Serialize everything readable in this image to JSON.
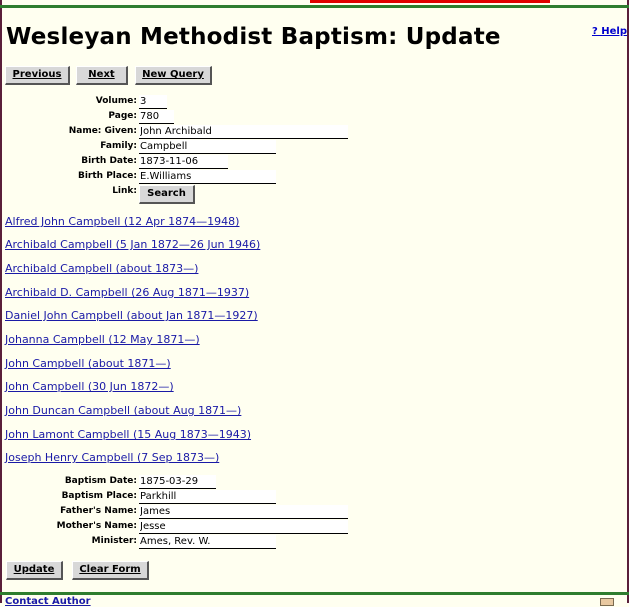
{
  "page": {
    "title": "Wesleyan Methodist Baptism: Update",
    "help_label": "? Help"
  },
  "nav": {
    "previous": "Previous",
    "next": "Next",
    "new_query": "New Query"
  },
  "query": {
    "volume_label": "Volume:",
    "volume": "3",
    "page_label": "Page:",
    "page": "780",
    "given_label": "Name: Given:",
    "given": "John Archibald",
    "family_label": "Family:",
    "family": "Campbell",
    "birth_date_label": "Birth Date:",
    "birth_date": "1873-11-06",
    "birth_place_label": "Birth Place:",
    "birth_place": "E.Williams",
    "link_label": "Link:",
    "search_button": "Search"
  },
  "results": [
    "Alfred John Campbell (12 Apr 1874—1948)",
    "Archibald Campbell (5 Jan 1872—26 Jun 1946)",
    "Archibald Campbell (about 1873—)",
    "Archibald D. Campbell (26 Aug 1871—1937)",
    "Daniel John Campbell (about Jan 1871—1927)",
    "Johanna Campbell (12 May 1871—)",
    "John Campbell (about 1871—)",
    "John Campbell (30 Jun 1872—)",
    "John Duncan Campbell (about Aug 1871—)",
    "John Lamont Campbell (15 Aug 1873—1943)",
    "Joseph Henry Campbell (7 Sep 1873—)"
  ],
  "baptism": {
    "date_label": "Baptism Date:",
    "date": "1875-03-29",
    "place_label": "Baptism Place:",
    "place": "Parkhill",
    "father_label": "Father's Name:",
    "father": "James",
    "mother_label": "Mother's Name:",
    "mother": "Jesse",
    "minister_label": "Minister:",
    "minister": "Ames, Rev. W."
  },
  "actions": {
    "update": "Update",
    "clear": "Clear Form"
  },
  "footer": {
    "contact": "Contact Author"
  },
  "colors": {
    "background": "#fffff0",
    "link": "#1a1aa6",
    "rule": "#2e7d2e",
    "accent_red": "#e00000"
  }
}
